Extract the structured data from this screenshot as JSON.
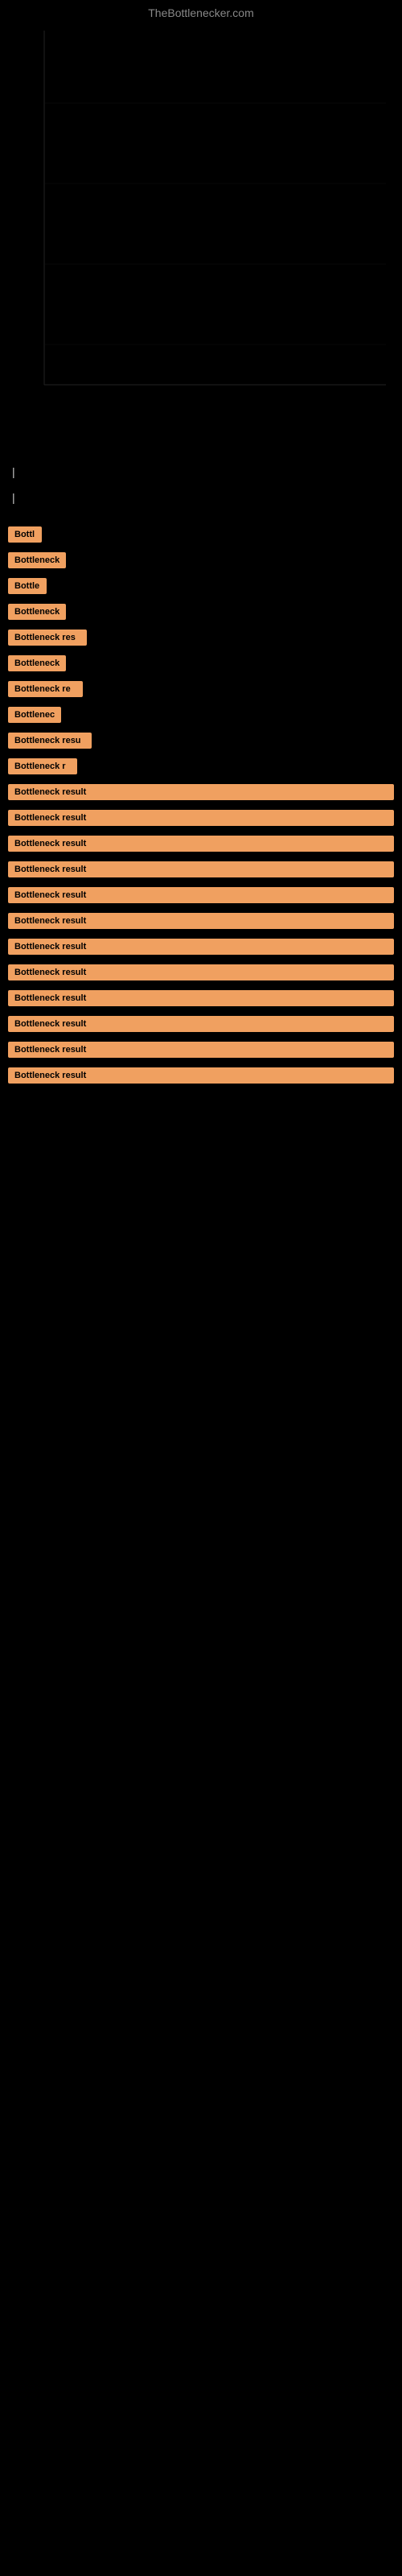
{
  "site": {
    "title": "TheBottlenecker.com"
  },
  "results": [
    {
      "id": 1,
      "label": "Bottleneck result",
      "visible_text": "Bottl",
      "approximate_width": 40
    },
    {
      "id": 2,
      "label": "Bottleneck result",
      "visible_text": "Bottleneck",
      "approximate_width": 70
    },
    {
      "id": 3,
      "label": "Bottleneck result",
      "visible_text": "Bottle",
      "approximate_width": 45
    },
    {
      "id": 4,
      "label": "Bottleneck result",
      "visible_text": "Bottleneck",
      "approximate_width": 70
    },
    {
      "id": 5,
      "label": "Bottleneck result",
      "visible_text": "Bottleneck res",
      "approximate_width": 95
    },
    {
      "id": 6,
      "label": "Bottleneck result",
      "visible_text": "Bottleneck",
      "approximate_width": 70
    },
    {
      "id": 7,
      "label": "Bottleneck result",
      "visible_text": "Bottleneck re",
      "approximate_width": 90
    },
    {
      "id": 8,
      "label": "Bottleneck result",
      "visible_text": "Bottlenec",
      "approximate_width": 63
    },
    {
      "id": 9,
      "label": "Bottleneck result",
      "visible_text": "Bottleneck resu",
      "approximate_width": 100
    },
    {
      "id": 10,
      "label": "Bottleneck result",
      "visible_text": "Bottleneck r",
      "approximate_width": 82
    },
    {
      "id": 11,
      "label": "Bottleneck result",
      "visible_text": "Bottleneck result",
      "approximate_width": 115
    },
    {
      "id": 12,
      "label": "Bottleneck result",
      "visible_text": "Bottleneck result",
      "approximate_width": 115
    },
    {
      "id": 13,
      "label": "Bottleneck result",
      "visible_text": "Bottleneck result",
      "approximate_width": 115
    },
    {
      "id": 14,
      "label": "Bottleneck result",
      "visible_text": "Bottleneck result",
      "approximate_width": 115
    },
    {
      "id": 15,
      "label": "Bottleneck result",
      "visible_text": "Bottleneck result",
      "approximate_width": 115
    },
    {
      "id": 16,
      "label": "Bottleneck result",
      "visible_text": "Bottleneck result",
      "approximate_width": 115
    },
    {
      "id": 17,
      "label": "Bottleneck result",
      "visible_text": "Bottleneck result",
      "approximate_width": 115
    },
    {
      "id": 18,
      "label": "Bottleneck result",
      "visible_text": "Bottleneck result",
      "approximate_width": 115
    },
    {
      "id": 19,
      "label": "Bottleneck result",
      "visible_text": "Bottleneck result",
      "approximate_width": 115
    },
    {
      "id": 20,
      "label": "Bottleneck result",
      "visible_text": "Bottleneck result",
      "approximate_width": 115
    },
    {
      "id": 21,
      "label": "Bottleneck result",
      "visible_text": "Bottleneck result",
      "approximate_width": 115
    },
    {
      "id": 22,
      "label": "Bottleneck result",
      "visible_text": "Bottleneck result",
      "approximate_width": 115
    }
  ],
  "badge_color": "#f0a060"
}
